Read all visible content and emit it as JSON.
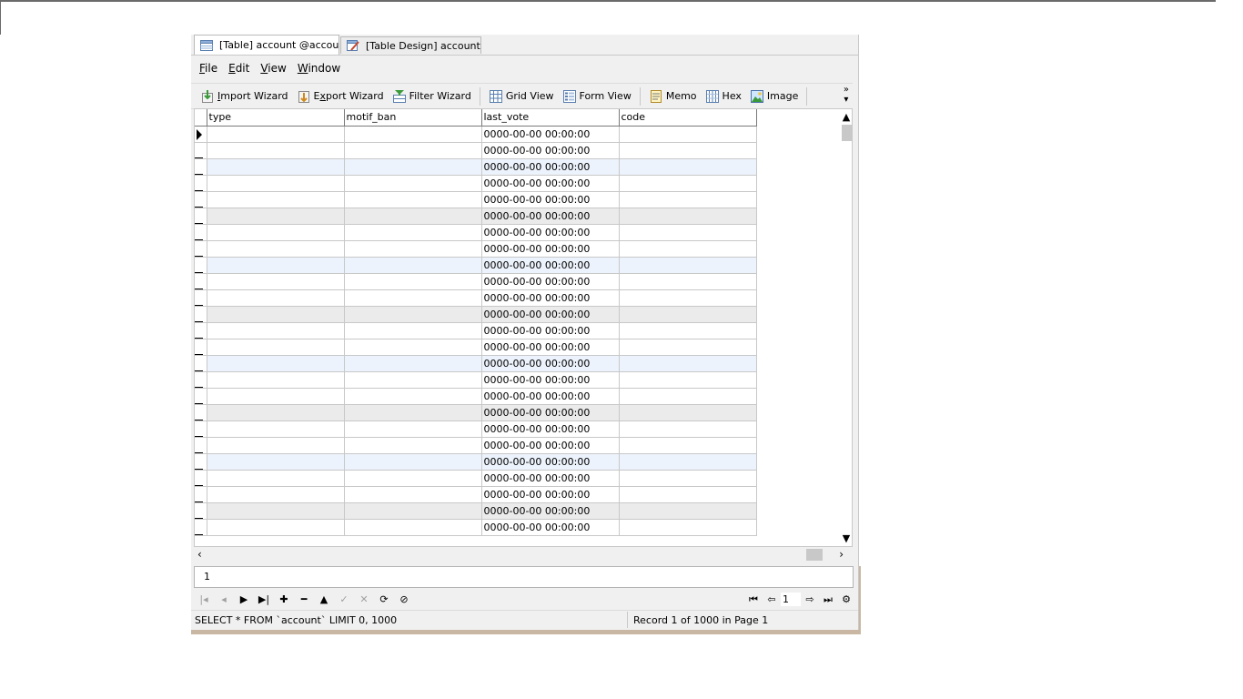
{
  "tabs": [
    {
      "label": "[Table] account @accou...",
      "icon": "table-icon",
      "active": true
    },
    {
      "label": "[Table Design] account ...",
      "icon": "table-design-icon",
      "active": false
    }
  ],
  "menu": [
    {
      "accel": "F",
      "rest": "ile"
    },
    {
      "accel": "E",
      "rest": "dit"
    },
    {
      "accel": "V",
      "rest": "iew"
    },
    {
      "accel": "W",
      "rest": "indow"
    }
  ],
  "toolbar": {
    "import_wizard": {
      "accel": "I",
      "rest": "mport Wizard"
    },
    "export_wizard": {
      "pre": "E",
      "accel": "x",
      "rest": "port Wizard"
    },
    "filter_wizard": "Filter Wizard",
    "grid_view": "Grid View",
    "form_view": "Form View",
    "memo": "Memo",
    "hex": "Hex",
    "image": "Image",
    "more": "»"
  },
  "grid": {
    "columns": [
      "type",
      "motif_ban",
      "last_vote",
      "code"
    ],
    "rows_last_vote": [
      "0000-00-00 00:00:00",
      "0000-00-00 00:00:00",
      "0000-00-00 00:00:00",
      "0000-00-00 00:00:00",
      "0000-00-00 00:00:00",
      "0000-00-00 00:00:00",
      "0000-00-00 00:00:00",
      "0000-00-00 00:00:00",
      "0000-00-00 00:00:00",
      "0000-00-00 00:00:00",
      "0000-00-00 00:00:00",
      "0000-00-00 00:00:00",
      "0000-00-00 00:00:00",
      "0000-00-00 00:00:00",
      "0000-00-00 00:00:00",
      "0000-00-00 00:00:00",
      "0000-00-00 00:00:00",
      "0000-00-00 00:00:00",
      "0000-00-00 00:00:00",
      "0000-00-00 00:00:00",
      "0000-00-00 00:00:00",
      "0000-00-00 00:00:00",
      "0000-00-00 00:00:00",
      "0000-00-00 00:00:00",
      "0000-00-00 00:00:00"
    ]
  },
  "query_box": {
    "value": "1"
  },
  "navigator": {
    "page": "1"
  },
  "status": {
    "sql": "SELECT * FROM `account` LIMIT 0, 1000",
    "record": "Record 1 of 1000 in Page 1"
  },
  "colors": {
    "row_blue": "#edf3fc",
    "row_gray": "#ebebeb",
    "border": "#c8c8c8"
  }
}
